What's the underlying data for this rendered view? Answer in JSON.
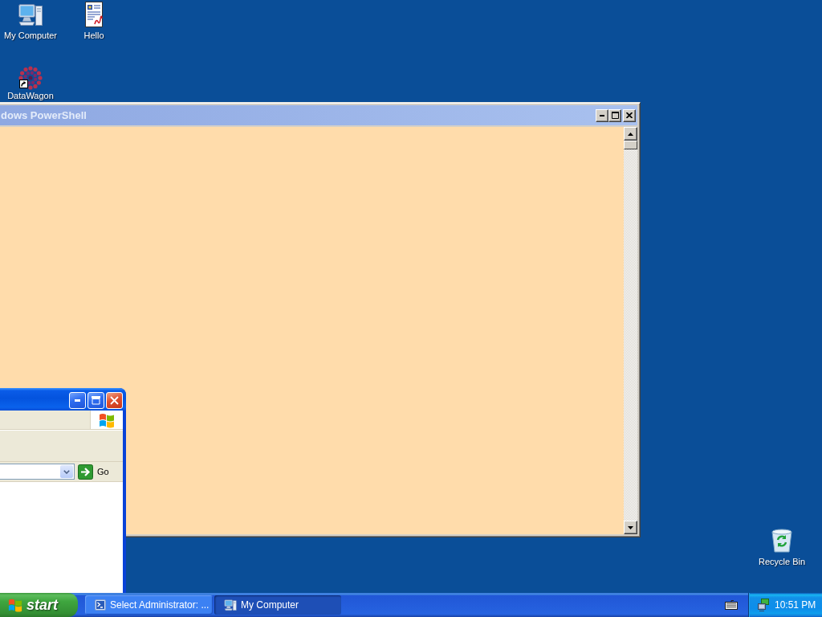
{
  "desktop": {
    "icons": [
      {
        "label": "My Computer",
        "kind": "computer"
      },
      {
        "label": "Hello",
        "kind": "document"
      },
      {
        "label": "DataWagon",
        "kind": "shortcut"
      },
      {
        "label": "Recycle Bin",
        "kind": "recycle-bin"
      }
    ]
  },
  "console_window": {
    "title": "dows PowerShell",
    "active": false
  },
  "explorer_window": {
    "active": true,
    "go_label": "Go"
  },
  "taskbar": {
    "start_label": "start",
    "tasks": [
      {
        "label": "Select Administrator: ...",
        "kind": "console",
        "selected": false
      },
      {
        "label": "My Computer",
        "kind": "computer",
        "selected": true
      }
    ],
    "clock": "10:51 PM"
  }
}
